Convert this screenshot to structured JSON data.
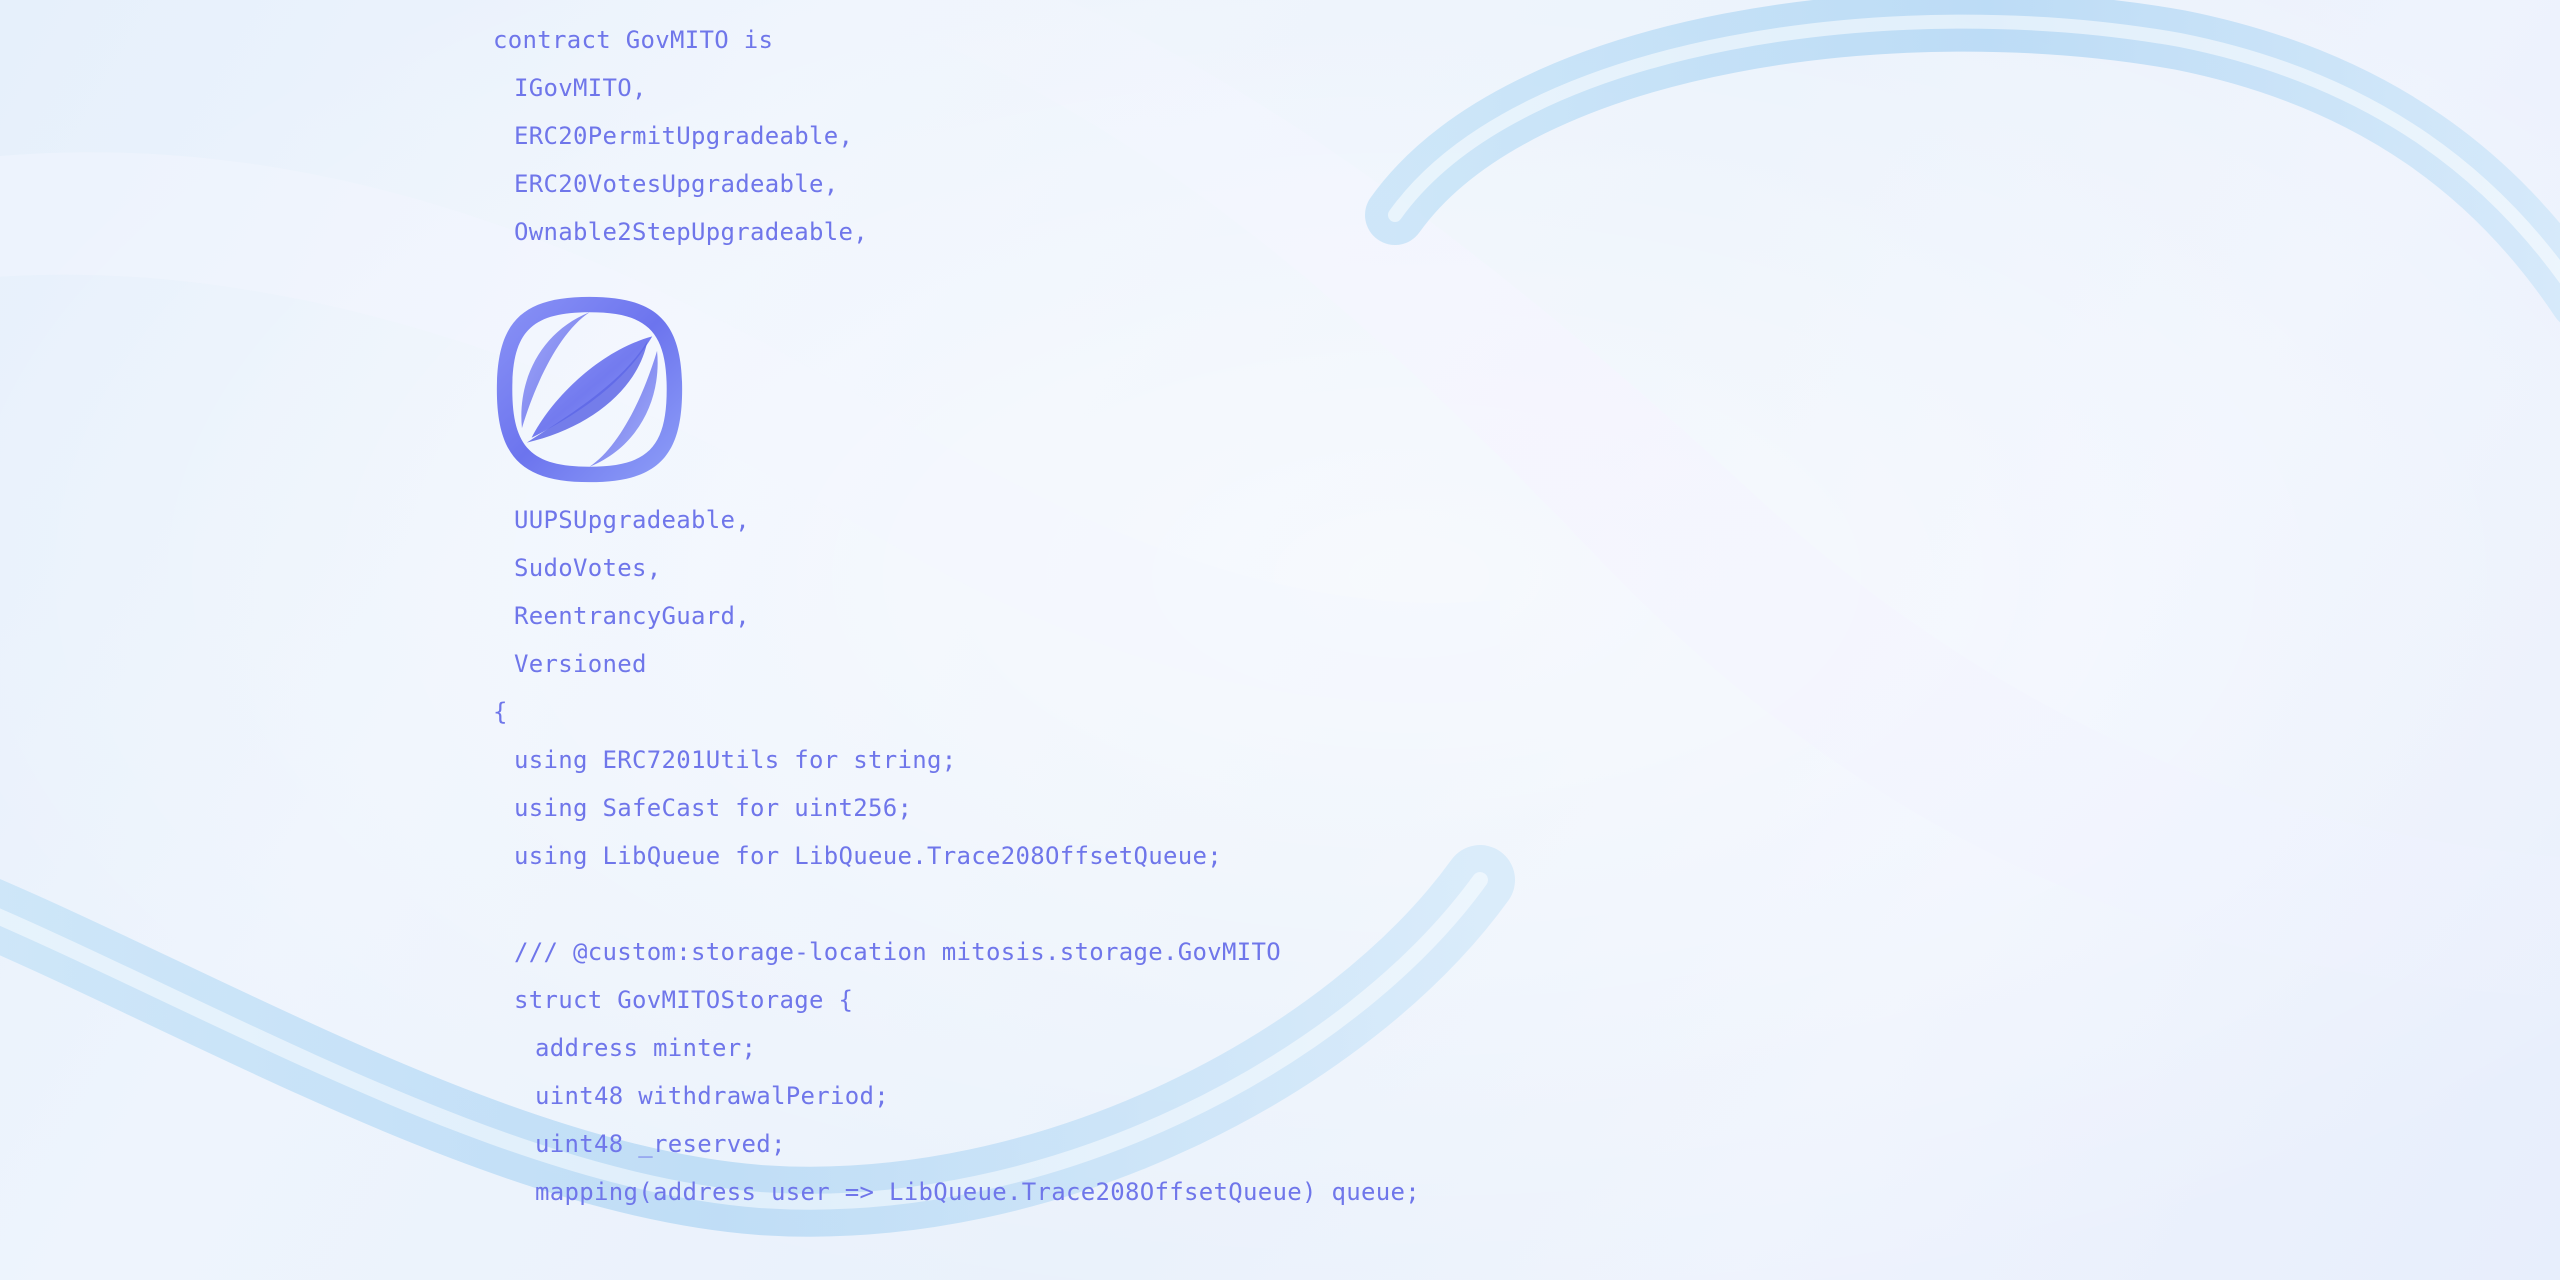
{
  "code": {
    "header_lines": [
      "contract GovMITO is",
      "IGovMITO,",
      "ERC20PermitUpgradeable,",
      "ERC20VotesUpgradeable,",
      "Ownable2StepUpgradeable,"
    ],
    "mid_lines": [
      "UUPSUpgradeable,",
      "SudoVotes,",
      "ReentrancyGuard,",
      "Versioned",
      "{",
      "using ERC7201Utils for string;",
      "using SafeCast for uint256;",
      "using LibQueue for LibQueue.Trace208OffsetQueue;"
    ],
    "storage_lines": [
      "/// @custom:storage-location mitosis.storage.GovMITO",
      "struct GovMITOStorage {",
      "address minter;",
      "uint48 withdrawalPeriod;",
      "uint48 _reserved;",
      "mapping(address user => LibQueue.Trace208OffsetQueue) queue;"
    ]
  },
  "colors": {
    "code_text": "#6f76ea",
    "logo": "#6f7af2",
    "background": "#e9f1fb"
  },
  "icons": {
    "logo": "mitosis-logo-icon"
  }
}
